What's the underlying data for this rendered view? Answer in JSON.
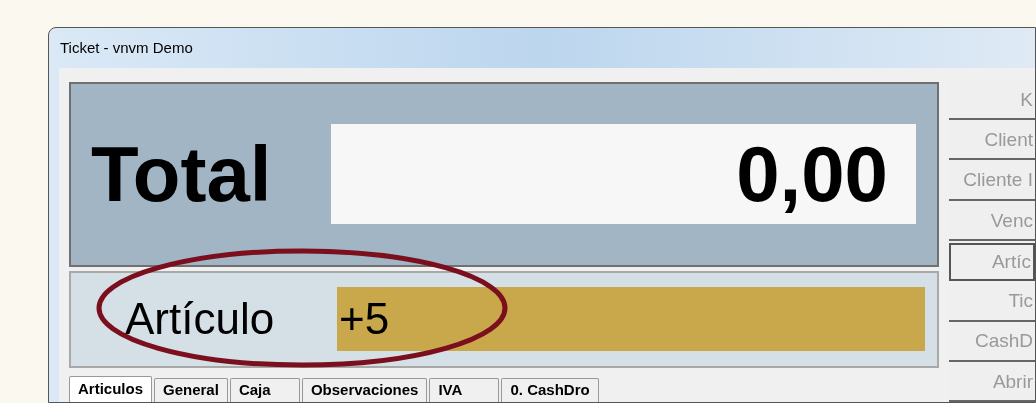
{
  "window": {
    "title": "Ticket - vnvm Demo"
  },
  "total": {
    "label": "Total",
    "value": "0,00"
  },
  "article": {
    "label": "Artículo",
    "value": "+5"
  },
  "annotation": {
    "kind": "ellipse"
  },
  "tabs": [
    {
      "label": "Articulos",
      "selected": true
    },
    {
      "label": "General",
      "selected": false
    },
    {
      "label": "Caja",
      "selected": false
    },
    {
      "label": "Observaciones",
      "selected": false
    },
    {
      "label": "IVA",
      "selected": false
    },
    {
      "label": "0. CashDro",
      "selected": false
    }
  ],
  "side_buttons": [
    {
      "label": "K",
      "selected": false
    },
    {
      "label": "Client",
      "selected": false
    },
    {
      "label": "Cliente I",
      "selected": false
    },
    {
      "label": "Venc",
      "selected": false
    },
    {
      "label": "Artíc",
      "selected": true
    },
    {
      "label": "Tic",
      "selected": false
    },
    {
      "label": "CashD",
      "selected": false
    },
    {
      "label": "Abrir",
      "selected": false
    }
  ]
}
